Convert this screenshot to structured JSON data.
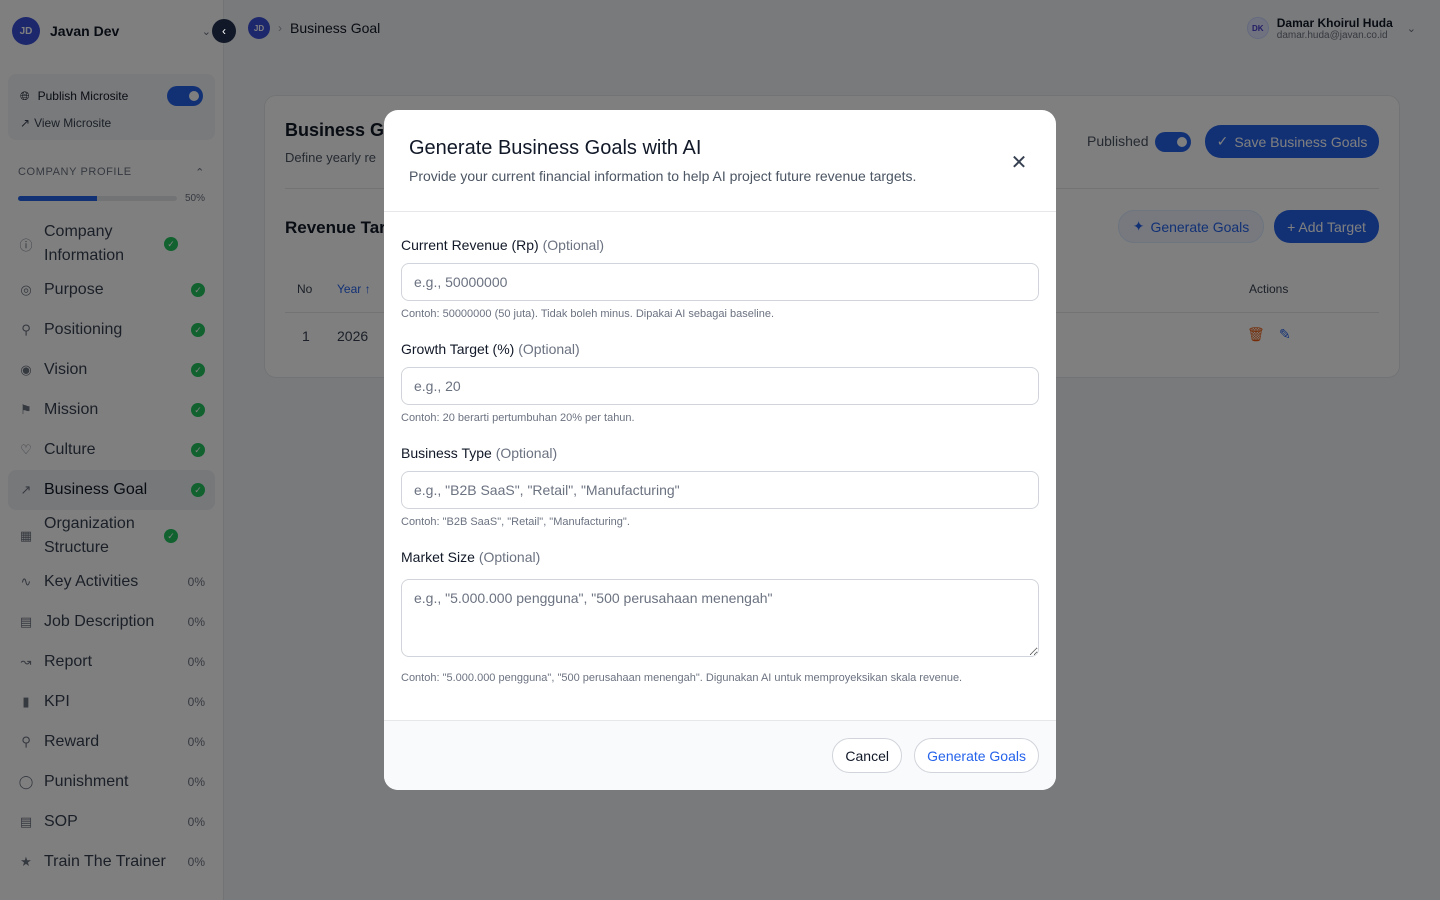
{
  "sidebar": {
    "workspace": {
      "initials": "JD",
      "name": "Javan Dev"
    },
    "publish": {
      "label": "Publish Microsite",
      "view_label": "View Microsite"
    },
    "section": {
      "title": "COMPANY PROFILE",
      "progress_text": "50%",
      "progress_fraction": 0.5
    },
    "items": [
      {
        "label": "Company Information",
        "status": "done"
      },
      {
        "label": "Purpose",
        "status": "done"
      },
      {
        "label": "Positioning",
        "status": "done"
      },
      {
        "label": "Vision",
        "status": "done"
      },
      {
        "label": "Mission",
        "status": "done"
      },
      {
        "label": "Culture",
        "status": "done"
      },
      {
        "label": "Business Goal",
        "status": "done"
      },
      {
        "label": "Organization Structure",
        "status": "done"
      },
      {
        "label": "Key Activities",
        "pct": "0%"
      },
      {
        "label": "Job Description",
        "pct": "0%"
      },
      {
        "label": "Report",
        "pct": "0%"
      },
      {
        "label": "KPI",
        "pct": "0%"
      },
      {
        "label": "Reward",
        "pct": "0%"
      },
      {
        "label": "Punishment",
        "pct": "0%"
      },
      {
        "label": "SOP",
        "pct": "0%"
      },
      {
        "label": "Train The Trainer",
        "pct": "0%"
      }
    ]
  },
  "topbar": {
    "breadcrumb_initials": "JD",
    "breadcrumb": "Business Goal",
    "user": {
      "initials": "DK",
      "name": "Damar Khoirul Huda",
      "email": "damar.huda@javan.co.id"
    }
  },
  "page": {
    "title": "Business Go",
    "subtitle": "Define yearly re",
    "published_label": "Published",
    "save_label": "Save Business Goals",
    "revenue_title": "Revenue Tar",
    "generate_label": "Generate Goals",
    "add_label": "+ Add Target",
    "table": {
      "headers": {
        "no": "No",
        "year": "Year",
        "actions": "Actions"
      },
      "rows": [
        {
          "no": "1",
          "year": "2026"
        }
      ]
    }
  },
  "modal": {
    "title": "Generate Business Goals with AI",
    "subtitle": "Provide your current financial information to help AI project future revenue targets.",
    "fields": [
      {
        "label": "Current Revenue (Rp)",
        "optional": "(Optional)",
        "placeholder": "e.g., 50000000",
        "help": "Contoh: 50000000 (50 juta). Tidak boleh minus. Dipakai AI sebagai baseline."
      },
      {
        "label": "Growth Target (%)",
        "optional": "(Optional)",
        "placeholder": "e.g., 20",
        "help": "Contoh: 20 berarti pertumbuhan 20% per tahun."
      },
      {
        "label": "Business Type",
        "optional": "(Optional)",
        "placeholder": "e.g., \"B2B SaaS\", \"Retail\", \"Manufacturing\"",
        "help": "Contoh: \"B2B SaaS\", \"Retail\", \"Manufacturing\"."
      },
      {
        "label": "Market Size",
        "optional": "(Optional)",
        "placeholder": "e.g., \"5.000.000 pengguna\", \"500 perusahaan menengah\"",
        "help": "Contoh: \"5.000.000 pengguna\", \"500 perusahaan menengah\". Digunakan AI untuk memproyeksikan skala revenue."
      }
    ],
    "cancel_label": "Cancel",
    "generate_label": "Generate Goals"
  }
}
